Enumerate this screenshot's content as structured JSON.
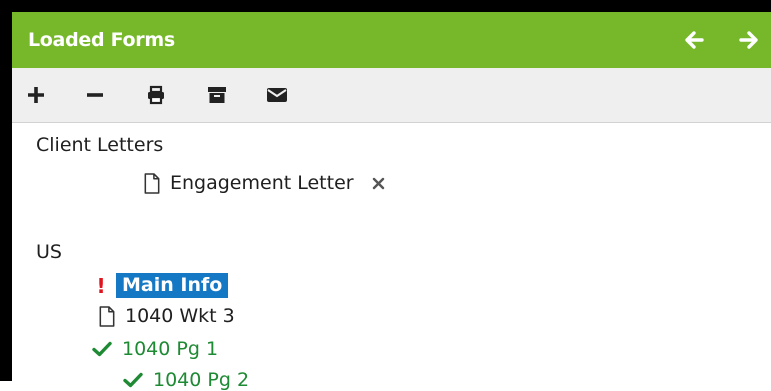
{
  "header": {
    "title": "Loaded Forms"
  },
  "toolbar": {
    "items": [
      {
        "name": "add",
        "icon": "plus-icon"
      },
      {
        "name": "remove",
        "icon": "minus-icon"
      },
      {
        "name": "print",
        "icon": "print-icon"
      },
      {
        "name": "archive",
        "icon": "archive-icon"
      },
      {
        "name": "email",
        "icon": "envelope-icon"
      }
    ]
  },
  "colors": {
    "header_bg": "#77b82a",
    "selected_bg": "#1478c4",
    "check": "#1f8a34",
    "error": "#e0141e"
  },
  "tree": {
    "groups": [
      {
        "label": "Client Letters",
        "items": [
          {
            "label": "Engagement Letter",
            "status": "document",
            "removable": true
          }
        ]
      },
      {
        "label": "US",
        "items": [
          {
            "label": "Main Info",
            "status": "error",
            "marker": "!",
            "selected": true
          },
          {
            "label": "1040 Wkt 3",
            "status": "document"
          },
          {
            "label": "1040 Pg 1",
            "status": "complete"
          },
          {
            "label": "1040 Pg 2",
            "status": "complete"
          }
        ]
      }
    ]
  }
}
